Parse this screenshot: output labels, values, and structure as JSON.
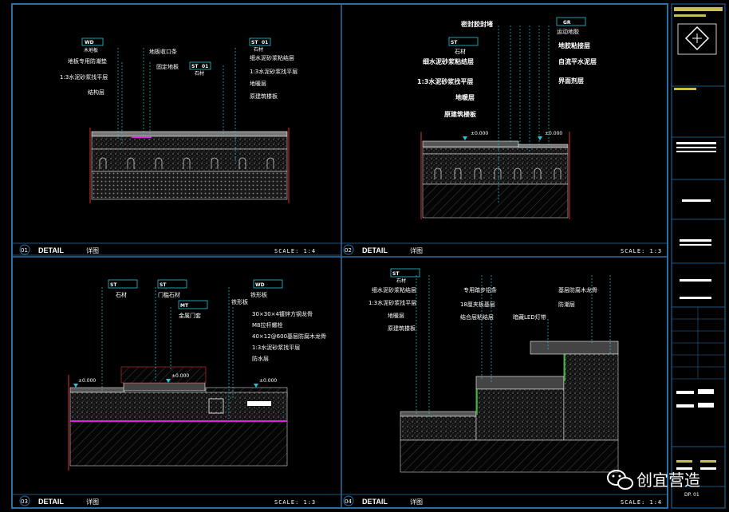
{
  "colors": {
    "background": "#000000",
    "frame": "#2a6fa6",
    "leader": "#26c6d8",
    "accent_magenta": "#e020e0",
    "titleblock_yellow": "#c8c050",
    "concrete": "#9a9a9a"
  },
  "panels": [
    {
      "number": "01",
      "title": "DETAIL",
      "subtitle": "详图",
      "scale": "SCALE: 1:4",
      "labels_left": [
        "木地板",
        "地板专用防潮垫",
        "1:3水泥砂浆找平层",
        "结构层"
      ],
      "labels_mid": [
        "地板收口条",
        "固定地板"
      ],
      "labels_right": [
        "石材",
        "细水泥砂浆粘结层",
        "1:3水泥砂浆找平层",
        "地暖层",
        "原建筑楼板"
      ],
      "tags": [
        {
          "code": "WD",
          "note": ""
        },
        {
          "code": "ST",
          "note": "01"
        },
        {
          "code": "ST",
          "note": "01"
        }
      ],
      "tag_sub": [
        "木地板",
        "石材",
        "石材"
      ]
    },
    {
      "number": "02",
      "title": "DETAIL",
      "subtitle": "详图",
      "scale": "SCALE: 1:3",
      "labels_left": [
        "密封胶封堵",
        "石材",
        "细水泥砂浆粘结层",
        "1:3水泥砂浆找平层",
        "地暖层",
        "原建筑楼板"
      ],
      "labels_right": [
        "运动地胶",
        "地胶粘接层",
        "自流平水泥层",
        "界面剂层"
      ],
      "tags": [
        {
          "code": "ST",
          "note": ""
        },
        {
          "code": "GR",
          "note": ""
        }
      ],
      "levels": [
        "±0.000",
        "±0.000"
      ]
    },
    {
      "number": "03",
      "title": "DETAIL",
      "subtitle": "详图",
      "scale": "SCALE: 1:3",
      "tags": [
        {
          "code": "ST",
          "sub": "石材"
        },
        {
          "code": "ST",
          "sub": "门槛石材"
        },
        {
          "code": "MT",
          "sub": "金属门套"
        },
        {
          "code": "WD",
          "sub": "铁形板"
        }
      ],
      "labels_right": [
        "铁形板",
        "30×30×4镀锌方钢龙骨",
        "M8拉杆螺栓",
        "40×12@600基层防腐木龙骨",
        "1:3水泥砂浆找平层",
        "防水层"
      ],
      "levels": [
        "±0.000",
        "±0.000",
        "±0.000"
      ]
    },
    {
      "number": "04",
      "title": "DETAIL",
      "subtitle": "详图",
      "scale": "SCALE: 1:4",
      "labels_left": [
        "细水泥砂浆粘结层",
        "1:3水泥砂浆找平层",
        "地暖层",
        "原建筑楼板"
      ],
      "labels_mid": [
        "专用踏步铝条",
        "18厘夹板基层",
        "结合层粘结层",
        "暗藏LED灯带"
      ],
      "labels_right": [
        "基层防腐木龙骨",
        "防潮层"
      ],
      "tags": [
        {
          "code": "ST",
          "sub": "石材"
        }
      ]
    }
  ],
  "title_block": {
    "company": "创宜营造",
    "drawing_no": "DP. 01",
    "watermark": "创宜营造"
  }
}
